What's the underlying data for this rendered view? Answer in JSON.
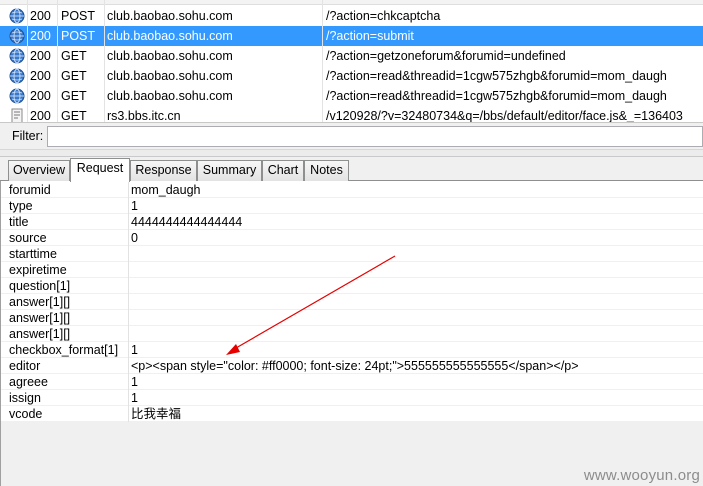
{
  "requests": [
    {
      "status": "200",
      "method": "POST",
      "host": "club.baobao.sohu.com",
      "path": "/?action=chkcaptcha",
      "icon": "globe-icon"
    },
    {
      "status": "200",
      "method": "POST",
      "host": "club.baobao.sohu.com",
      "path": "/?action=submit",
      "icon": "globe-icon",
      "selected": true
    },
    {
      "status": "200",
      "method": "GET",
      "host": "club.baobao.sohu.com",
      "path": "/?action=getzoneforum&forumid=undefined",
      "icon": "globe-icon"
    },
    {
      "status": "200",
      "method": "GET",
      "host": "club.baobao.sohu.com",
      "path": "/?action=read&threadid=1cgw575zhgb&forumid=mom_daugh",
      "icon": "globe-icon"
    },
    {
      "status": "200",
      "method": "GET",
      "host": "club.baobao.sohu.com",
      "path": "/?action=read&threadid=1cgw575zhgb&forumid=mom_daugh",
      "icon": "globe-icon"
    },
    {
      "status": "200",
      "method": "GET",
      "host": "rs3.bbs.itc.cn",
      "path": "/v120928/?v=32480734&q=/bbs/default/editor/face.js&_=136403",
      "icon": "script-icon"
    }
  ],
  "filter": {
    "label": "Filter:",
    "value": ""
  },
  "tabs": [
    {
      "label": "Overview",
      "active": false
    },
    {
      "label": "Request",
      "active": true
    },
    {
      "label": "Response",
      "active": false
    },
    {
      "label": "Summary",
      "active": false
    },
    {
      "label": "Chart",
      "active": false
    },
    {
      "label": "Notes",
      "active": false
    }
  ],
  "params": [
    {
      "key": "forumid",
      "value": "mom_daugh"
    },
    {
      "key": "type",
      "value": "1"
    },
    {
      "key": "title",
      "value": "4444444444444444"
    },
    {
      "key": "source",
      "value": "0"
    },
    {
      "key": "starttime",
      "value": ""
    },
    {
      "key": "expiretime",
      "value": ""
    },
    {
      "key": "question[1]",
      "value": ""
    },
    {
      "key": "answer[1][]",
      "value": ""
    },
    {
      "key": "answer[1][]",
      "value": ""
    },
    {
      "key": "answer[1][]",
      "value": ""
    },
    {
      "key": "checkbox_format[1]",
      "value": "1"
    },
    {
      "key": "editor",
      "value": "<p><span style=\"color: #ff0000; font-size: 24pt;\">555555555555555</span></p>"
    },
    {
      "key": "agreee",
      "value": "1"
    },
    {
      "key": "issign",
      "value": "1"
    },
    {
      "key": "vcode",
      "value": "比我幸福"
    }
  ],
  "colors": {
    "selection": "#3399ff",
    "arrow": "#e60000"
  },
  "watermark": "www.wooyun.org"
}
